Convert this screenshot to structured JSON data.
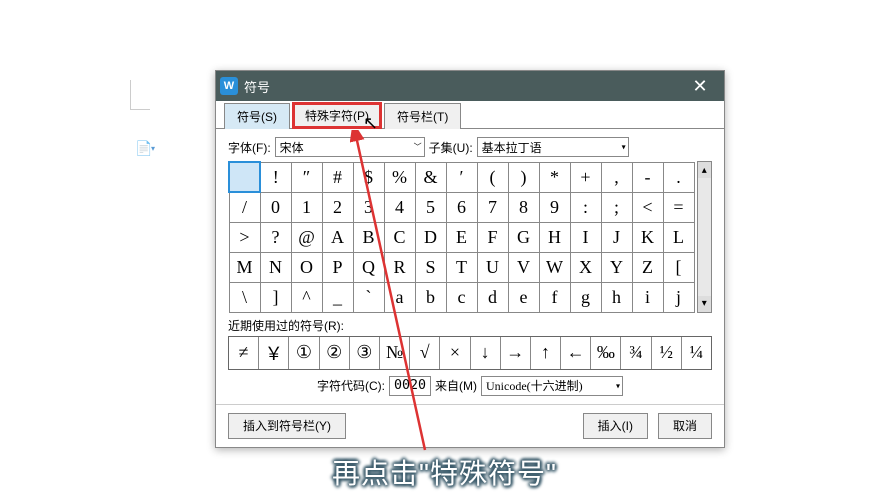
{
  "dialog": {
    "title": "符号",
    "logo": "W",
    "tabs": [
      {
        "label": "符号(S)",
        "active": true
      },
      {
        "label": "特殊字符(P)",
        "highlight": true
      },
      {
        "label": "符号栏(T)"
      }
    ],
    "font_label": "字体(F):",
    "font_value": "宋体",
    "subset_label": "子集(U):",
    "subset_value": "基本拉丁语",
    "grid": [
      [
        " ",
        "!",
        "″",
        "#",
        "$",
        "%",
        "&",
        "′",
        "(",
        ")",
        "*",
        "+",
        ",",
        "-",
        "."
      ],
      [
        "/",
        "0",
        "1",
        "2",
        "3",
        "4",
        "5",
        "6",
        "7",
        "8",
        "9",
        ":",
        ";",
        "<",
        "="
      ],
      [
        ">",
        "?",
        "@",
        "A",
        "B",
        "C",
        "D",
        "E",
        "F",
        "G",
        "H",
        "I",
        "J",
        "K",
        "L"
      ],
      [
        "M",
        "N",
        "O",
        "P",
        "Q",
        "R",
        "S",
        "T",
        "U",
        "V",
        "W",
        "X",
        "Y",
        "Z",
        "["
      ],
      [
        "\\",
        "]",
        "^",
        "_",
        "`",
        "a",
        "b",
        "c",
        "d",
        "e",
        "f",
        "g",
        "h",
        "i",
        "j"
      ]
    ],
    "recent_label": "近期使用过的符号(R):",
    "recent": [
      "≠",
      "￥",
      "①",
      "②",
      "③",
      "№",
      "√",
      "×",
      "↓",
      "→",
      "↑",
      "←",
      "‰",
      "¾",
      "½",
      "¼"
    ],
    "code_label": "字符代码(C):",
    "code_value": "0020",
    "from_label": "来自(M)",
    "from_value": "Unicode(十六进制)",
    "buttons": {
      "insert_to_bar": "插入到符号栏(Y)",
      "insert": "插入(I)",
      "cancel": "取消"
    }
  },
  "caption": "再点击\"特殊符号\""
}
